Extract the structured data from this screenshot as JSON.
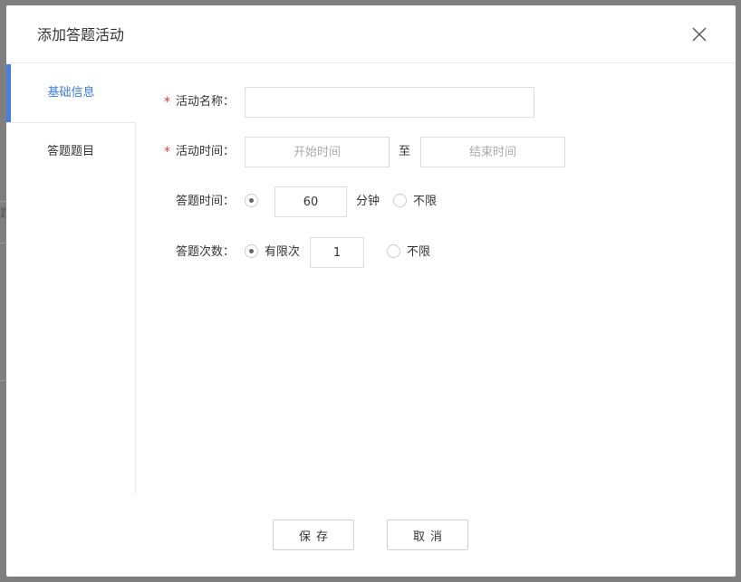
{
  "dialog": {
    "title": "添加答题活动"
  },
  "side_nav": {
    "items": [
      {
        "label": "基础信息",
        "active": true
      },
      {
        "label": "答题题目",
        "active": false
      }
    ]
  },
  "form": {
    "activity_name": {
      "required_mark": "*",
      "label": "活动名称：",
      "value": ""
    },
    "activity_time": {
      "required_mark": "*",
      "label": "活动时间：",
      "start_placeholder": "开始时间",
      "separator": "至",
      "end_placeholder": "结束时间"
    },
    "answer_time": {
      "label": "答题时间：",
      "value": "60",
      "unit": "分钟",
      "unlimited_label": "不限",
      "selected": "limited"
    },
    "answer_count": {
      "label": "答题次数：",
      "limited_label": "有限次",
      "value": "1",
      "unlimited_label": "不限",
      "selected": "limited"
    }
  },
  "footer": {
    "save_label": "保存",
    "cancel_label": "取消"
  },
  "background": {
    "partial_text": "题"
  },
  "colors": {
    "accent": "#4a7fe0",
    "required": "#e53935",
    "overlay": "#7f7f7f"
  },
  "icons": {
    "close": "close-icon"
  }
}
